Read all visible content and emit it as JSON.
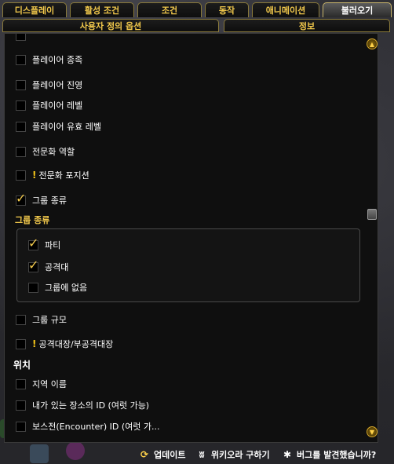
{
  "tabs": [
    {
      "label": "디스플레이"
    },
    {
      "label": "활성 조건"
    },
    {
      "label": "조건"
    },
    {
      "label": "동작"
    },
    {
      "label": "애니메이션"
    },
    {
      "label": "불러오기"
    }
  ],
  "subtabs": [
    {
      "label": "사용자 정의 옵션"
    },
    {
      "label": "정보"
    }
  ],
  "options": [
    {
      "label": "플레이어 종족",
      "checked": false
    },
    {
      "label": "플레이어 진영",
      "checked": false
    },
    {
      "label": "플레이어 레벨",
      "checked": false
    },
    {
      "label": "플레이어 유효 레벨",
      "checked": false
    },
    {
      "label": "전문화 역할",
      "checked": false
    },
    {
      "label": "전문화 포지션",
      "checked": false,
      "warning": true
    },
    {
      "label": "그룹 종류",
      "checked": true
    }
  ],
  "group_type": {
    "title": "그룹 종류",
    "items": [
      {
        "label": "파티",
        "checked": true
      },
      {
        "label": "공격대",
        "checked": true
      },
      {
        "label": "그룹에 없음",
        "checked": false
      }
    ]
  },
  "options_after": [
    {
      "label": "그룹 규모",
      "checked": false
    },
    {
      "label": "공격대장/부공격대장",
      "checked": false,
      "warning": true
    }
  ],
  "location_section": {
    "title": "위치",
    "items": [
      {
        "label": "지역 이름",
        "checked": false
      },
      {
        "label": "내가 있는 장소의 ID (여럿 가능)",
        "checked": false
      },
      {
        "label": "보스전(Encounter) ID (여럿 가...",
        "checked": false
      }
    ]
  },
  "footer": {
    "update": "업데이트",
    "wiki": "위키오라 구하기",
    "bug": "버그를 발견했습니까?"
  },
  "colors": {
    "accent": "#f2c94c",
    "panel": "#0f0f0f",
    "text": "#ffffff"
  }
}
